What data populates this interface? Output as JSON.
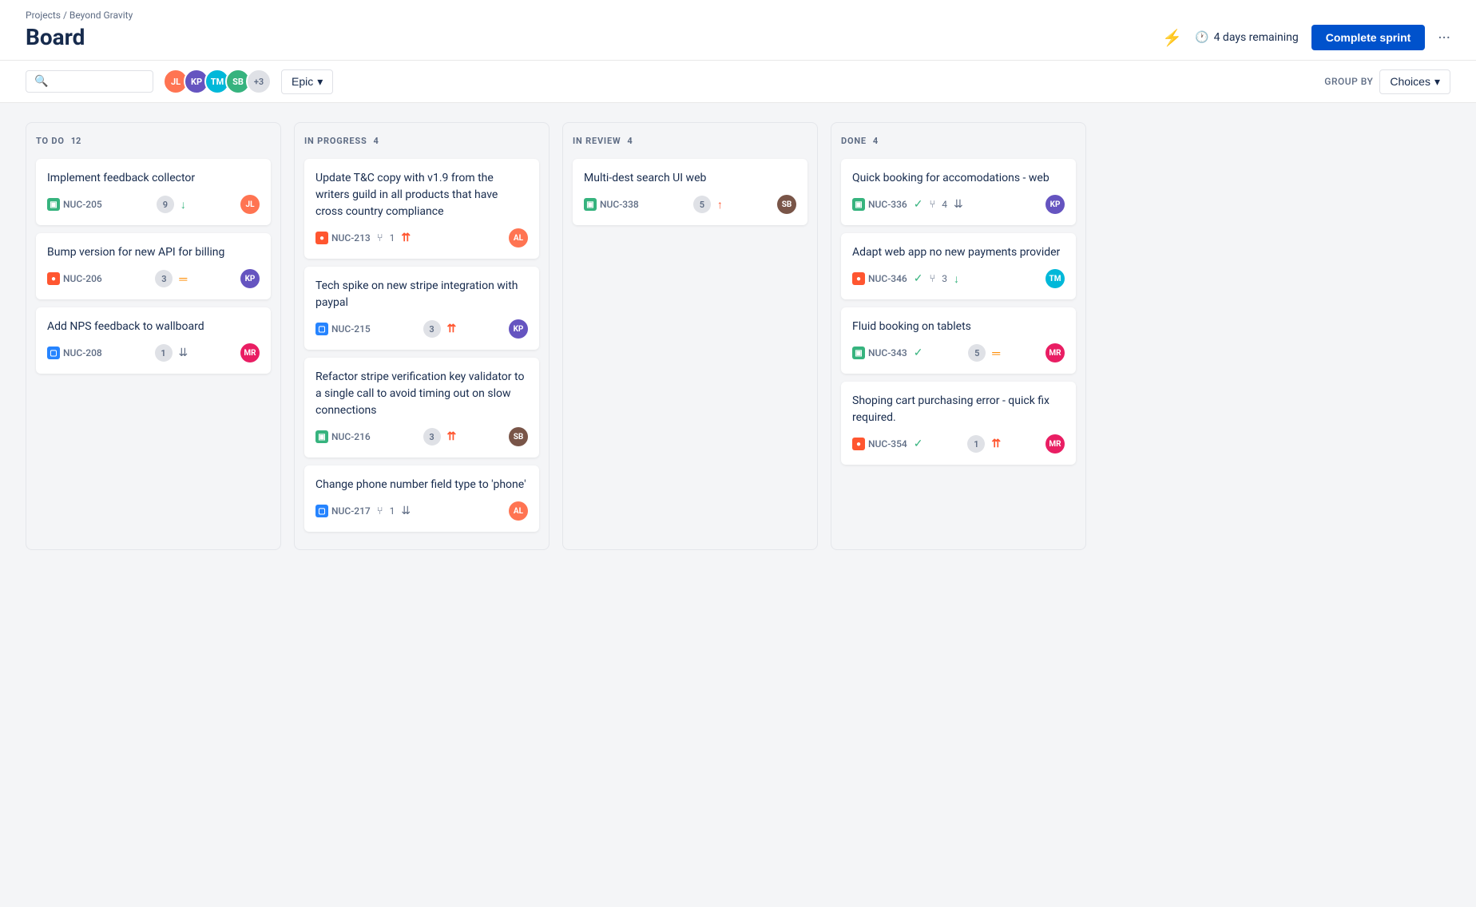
{
  "breadcrumb": "Projects / Beyond Gravity",
  "page_title": "Board",
  "header": {
    "time_remaining": "4 days remaining",
    "complete_sprint_label": "Complete sprint"
  },
  "toolbar": {
    "search_placeholder": "",
    "epic_label": "Epic",
    "group_by_label": "GROUP BY",
    "choices_label": "Choices",
    "extra_avatars": "+3"
  },
  "columns": [
    {
      "id": "todo",
      "title": "TO DO",
      "count": 12,
      "cards": [
        {
          "id": "card-205",
          "title": "Implement feedback collector",
          "issue_type": "story",
          "issue_id": "NUC-205",
          "count": 9,
          "priority": "low",
          "avatar_color": "#ff7452",
          "avatar_initials": "JL"
        },
        {
          "id": "card-206",
          "title": "Bump version for new API for billing",
          "issue_type": "bug",
          "issue_id": "NUC-206",
          "count": 3,
          "priority": "medium",
          "avatar_color": "#6554c0",
          "avatar_initials": "KP"
        },
        {
          "id": "card-208",
          "title": "Add NPS feedback to wallboard",
          "issue_type": "task",
          "issue_id": "NUC-208",
          "count": 1,
          "priority": "low_triple",
          "avatar_color": "#e91e63",
          "avatar_initials": "MR"
        }
      ]
    },
    {
      "id": "inprogress",
      "title": "IN PROGRESS",
      "count": 4,
      "cards": [
        {
          "id": "card-213",
          "title": "Update T&C copy with v1.9 from the writers guild in all products that have cross country compliance",
          "issue_type": "bug",
          "issue_id": "NUC-213",
          "branch_count": 1,
          "priority": "highest",
          "avatar_color": "#ff7452",
          "avatar_initials": "AL"
        },
        {
          "id": "card-215",
          "title": "Tech spike on new stripe integration with paypal",
          "issue_type": "task",
          "issue_id": "NUC-215",
          "count": 3,
          "priority": "highest",
          "avatar_color": "#6554c0",
          "avatar_initials": "KP"
        },
        {
          "id": "card-216",
          "title": "Refactor stripe verification key validator to a single call to avoid timing out on slow connections",
          "issue_type": "story",
          "issue_id": "NUC-216",
          "count": 3,
          "priority": "highest",
          "avatar_color": "#795548",
          "avatar_initials": "SB"
        },
        {
          "id": "card-217",
          "title": "Change phone number field type to 'phone'",
          "issue_type": "task",
          "issue_id": "NUC-217",
          "branch_count": 1,
          "priority": "low_triple",
          "avatar_color": "#ff7452",
          "avatar_initials": "AL"
        }
      ]
    },
    {
      "id": "inreview",
      "title": "IN REVIEW",
      "count": 4,
      "cards": [
        {
          "id": "card-338",
          "title": "Multi-dest search UI web",
          "issue_type": "story",
          "issue_id": "NUC-338",
          "count": 5,
          "priority": "high",
          "avatar_color": "#795548",
          "avatar_initials": "SB"
        }
      ]
    },
    {
      "id": "done",
      "title": "DONE",
      "count": 4,
      "cards": [
        {
          "id": "card-336",
          "title": "Quick booking for accomodations - web",
          "issue_type": "story",
          "issue_id": "NUC-336",
          "branch_count": 4,
          "priority": "low_triple",
          "avatar_color": "#6554c0",
          "avatar_initials": "KP"
        },
        {
          "id": "card-346",
          "title": "Adapt web app no new payments provider",
          "issue_type": "bug",
          "issue_id": "NUC-346",
          "branch_count": 3,
          "priority": "low",
          "avatar_color": "#00b8d9",
          "avatar_initials": "TM"
        },
        {
          "id": "card-343",
          "title": "Fluid booking on tablets",
          "issue_type": "story",
          "issue_id": "NUC-343",
          "count": 5,
          "priority": "medium",
          "avatar_color": "#e91e63",
          "avatar_initials": "MR"
        },
        {
          "id": "card-354",
          "title": "Shoping cart purchasing error - quick fix required.",
          "issue_type": "bug",
          "issue_id": "NUC-354",
          "count": 1,
          "priority": "highest",
          "avatar_color": "#e91e63",
          "avatar_initials": "MR"
        }
      ]
    }
  ]
}
